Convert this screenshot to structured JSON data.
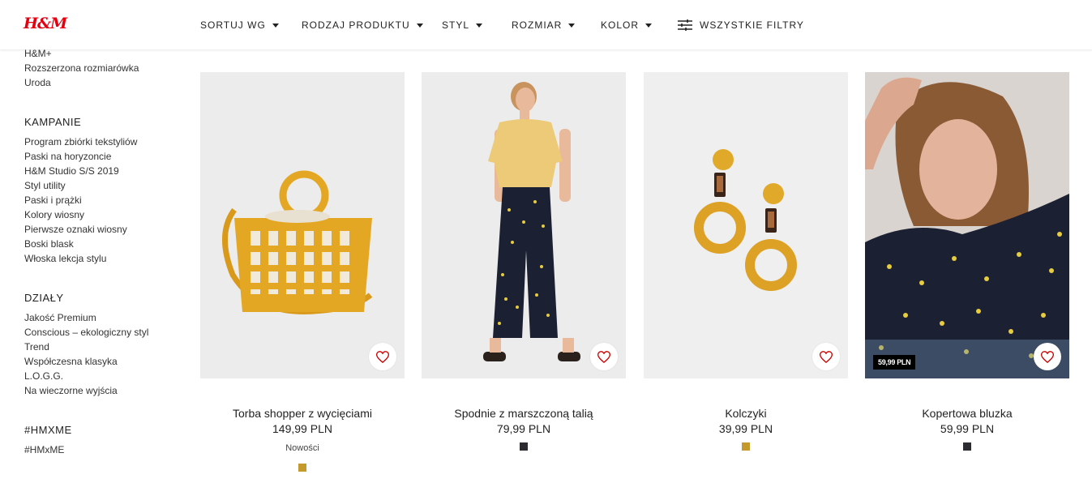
{
  "header": {
    "logo": "H&M",
    "filters": [
      {
        "label": "SORTUJ WG"
      },
      {
        "label": "RODZAJ PRODUKTU"
      },
      {
        "label": "STYL"
      },
      {
        "label": "ROZMIAR"
      },
      {
        "label": "KOLOR"
      }
    ],
    "all_filters_label": "WSZYSTKIE FILTRY"
  },
  "sidebar": {
    "top_links": [
      "H&M+",
      "Rozszerzona rozmiarówka",
      "Uroda"
    ],
    "sections": [
      {
        "heading": "KAMPANIE",
        "items": [
          "Program zbiórki tekstyliów",
          "Paski na horyzoncie",
          "H&M Studio S/S 2019",
          "Styl utility",
          "Paski i prążki",
          "Kolory wiosny",
          "Pierwsze oznaki wiosny",
          "Boski blask",
          "Włoska lekcja stylu"
        ]
      },
      {
        "heading": "DZIAŁY",
        "items": [
          "Jakość Premium",
          "Conscious – ekologiczny styl",
          "Trend",
          "Współczesna klasyka",
          "L.O.G.G.",
          "Na wieczorne wyjścia"
        ]
      },
      {
        "heading": "#HMXME",
        "items": [
          "#HMxME"
        ]
      }
    ]
  },
  "products": [
    {
      "name": "Torba shopper z wycięciami",
      "price": "149,99 PLN",
      "tag": "Nowości",
      "swatch": "#c49a2c",
      "badge": ""
    },
    {
      "name": "Spodnie z marszczoną talią",
      "price": "79,99 PLN",
      "tag": "",
      "swatch": "#2b2b30",
      "badge": ""
    },
    {
      "name": "Kolczyki",
      "price": "39,99 PLN",
      "tag": "",
      "swatch": "#c49a2c",
      "badge": ""
    },
    {
      "name": "Kopertowa bluzka",
      "price": "59,99 PLN",
      "tag": "",
      "swatch": "#2b2b30",
      "badge": "59,99 PLN"
    }
  ],
  "colors": {
    "brand_red": "#e50010",
    "heart_red": "#cc0000",
    "mustard": "#e4a723",
    "navy_print": "#1c2033"
  }
}
